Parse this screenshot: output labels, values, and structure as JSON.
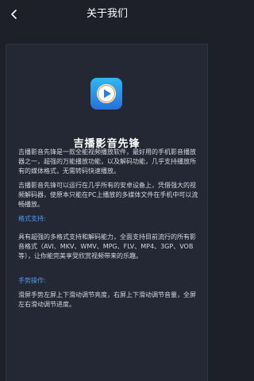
{
  "header": {
    "title": "关于我们"
  },
  "about": {
    "app_name": "吉播影音先锋",
    "intro_1": "吉播影音先锋是一款全能视频播放软件，最好用的手机影音播放器之一，超强的万能播放功能，以及解码功能，几乎支持播放所有的媒体格式，无需转码快速播放。",
    "intro_2": "吉播影音先锋可以运行在几乎所有的安卓设备上，凭借强大的视频解码器，使原本只能在PC上播放的多媒体文件在手机中可以流畅播放。",
    "formats_title": "格式支持:",
    "formats_text": "具有超强的多格式支持和解码能力，全面支持目前流行的所有影音格式（AVI、MKV、WMV、MPG、FLV、MP4、3GP、VOB等），让你能完美享受欣赏视频带来的乐趣。",
    "gestures_title": "手势操作:",
    "gestures_text": "滑屏手势左屏上下滑动调节亮度，右屏上下滑动调节音量，全屏左右滑动调节进度。"
  },
  "colors": {
    "background": "#1d2029",
    "card": "#242734",
    "accent": "#4f9bea",
    "icon_gradient_top": "#2fb8f2",
    "icon_gradient_bottom": "#2a6fd9"
  },
  "icons": {
    "back": "chevron-left-icon",
    "app": "play-icon"
  }
}
